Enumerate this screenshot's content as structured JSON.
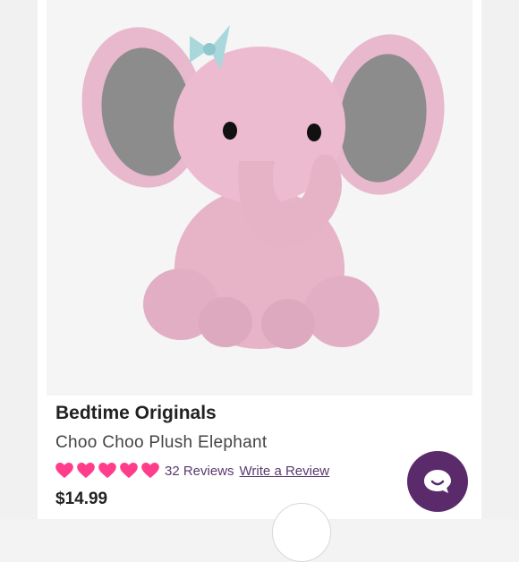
{
  "product": {
    "brand": "Bedtime Originals",
    "name": "Choo Choo Plush Elephant",
    "rating": 5,
    "rating_max": 5,
    "reviews_count": "32 Reviews",
    "write_review": "Write a Review",
    "price": "$14.99"
  },
  "colors": {
    "heart": "#ff3d8b",
    "link": "#5a3a6e",
    "chat_button": "#5b2a6b"
  },
  "icons": {
    "rating": "heart-icon",
    "chat": "chat-bubble-icon"
  }
}
